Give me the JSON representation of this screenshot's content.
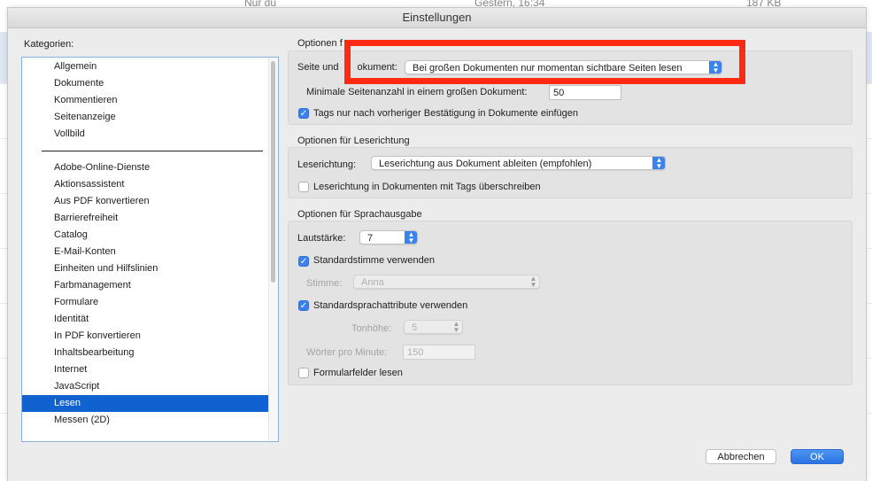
{
  "background": {
    "row_owner": "Nur du",
    "row_date": "Gestern, 16:34",
    "row_size": "187 KB"
  },
  "dialog": {
    "title": "Einstellungen",
    "categories_label": "Kategorien:",
    "categories_group1": [
      "Allgemein",
      "Dokumente",
      "Kommentieren",
      "Seitenanzeige",
      "Vollbild"
    ],
    "categories_group2": [
      "Adobe-Online-Dienste",
      "Aktionsassistent",
      "Aus PDF konvertieren",
      "Barrierefreiheit",
      "Catalog",
      "E-Mail-Konten",
      "Einheiten und Hilfslinien",
      "Farbmanagement",
      "Formulare",
      "Identität",
      "In PDF konvertieren",
      "Inhaltsbearbeitung",
      "Internet",
      "JavaScript",
      "Lesen",
      "Messen (2D)"
    ],
    "selected_category": "Lesen"
  },
  "options": {
    "section1_title": "Optionen f",
    "page_and_doc_label_a": "Seite und ",
    "page_and_doc_label_b": "okument:",
    "page_and_doc_value": "Bei großen Dokumenten nur momentan sichtbare Seiten lesen",
    "min_pages_label": "Minimale Seitenanzahl in einem großen Dokument:",
    "min_pages_value": "50",
    "tags_confirm_label": "Tags nur nach vorheriger Bestätigung in Dokumente einfügen",
    "tags_confirm_checked": true
  },
  "reading_direction": {
    "section_title": "Optionen für Leserichtung",
    "label": "Leserichtung:",
    "value": "Leserichtung aus Dokument ableiten (empfohlen)",
    "override_label": "Leserichtung in Dokumenten mit Tags überschreiben",
    "override_checked": false
  },
  "speech": {
    "section_title": "Optionen für Sprachausgabe",
    "volume_label": "Lautstärke:",
    "volume_value": "7",
    "default_voice_label": "Standardstimme verwenden",
    "default_voice_checked": true,
    "voice_label": "Stimme:",
    "voice_value": "Anna",
    "default_attr_label": "Standardsprachattribute verwenden",
    "default_attr_checked": true,
    "pitch_label": "Tonhöhe:",
    "pitch_value": "5",
    "wpm_label": "Wörter pro Minute:",
    "wpm_value": "150",
    "form_fields_label": "Formularfelder lesen",
    "form_fields_checked": false
  },
  "buttons": {
    "cancel": "Abbrechen",
    "ok": "OK"
  },
  "colors": {
    "selection": "#0f62d0",
    "accent": "#3b82f0",
    "highlight_box": "#ff2a12"
  }
}
